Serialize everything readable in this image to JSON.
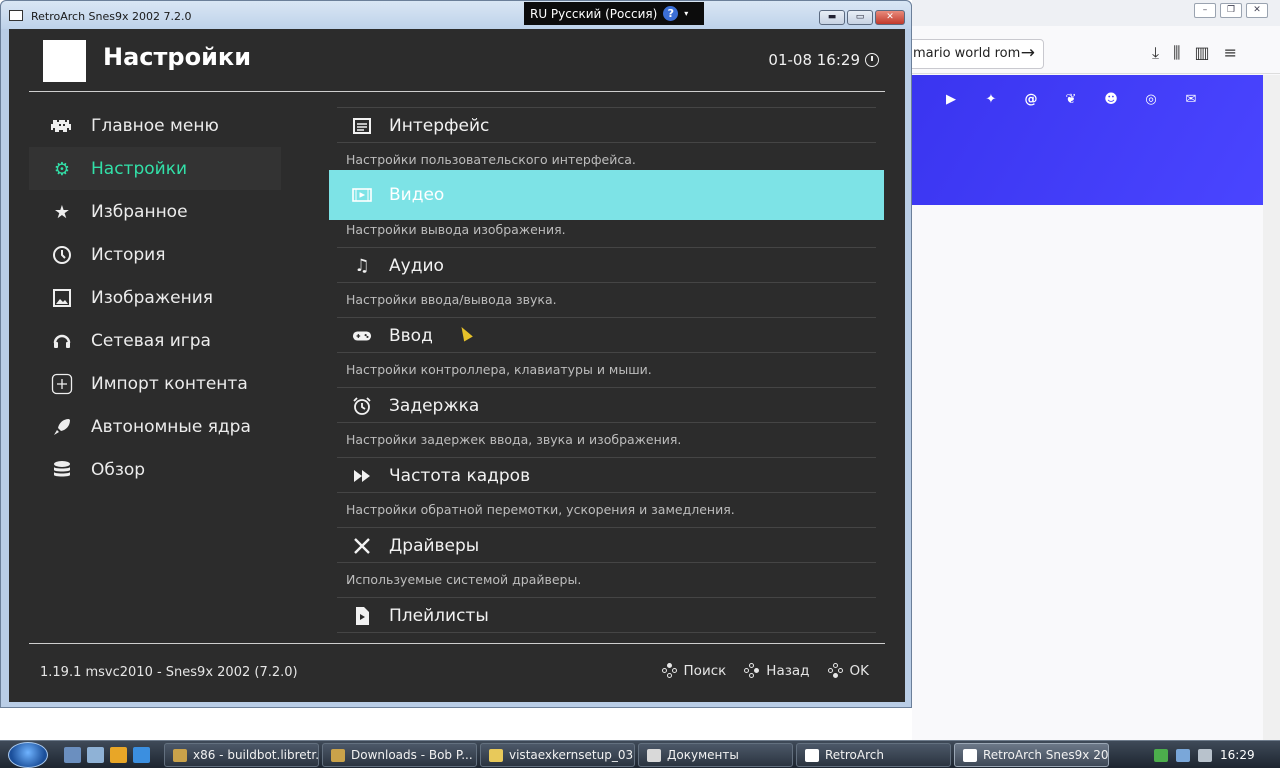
{
  "browser": {
    "url_fragment": "mario world rom",
    "social_icons": [
      "youtube-icon",
      "twitter-icon",
      "mastodon-icon",
      "bluesky-icon",
      "discord-icon",
      "github-icon",
      "email-icon"
    ],
    "banner_color": "#3d38f5"
  },
  "language_bar": {
    "label": "RU Русский (Россия)",
    "help": "?"
  },
  "window": {
    "title": "RetroArch Snes9x 2002 7.2.0"
  },
  "header": {
    "title": "Настройки",
    "clock": "01-08 16:29"
  },
  "sidebar": {
    "items": [
      {
        "label": "Главное меню",
        "icon": "invader-icon"
      },
      {
        "label": "Настройки",
        "icon": "gear-icon",
        "active": true
      },
      {
        "label": "Избранное",
        "icon": "star-icon"
      },
      {
        "label": "История",
        "icon": "history-icon"
      },
      {
        "label": "Изображения",
        "icon": "image-icon"
      },
      {
        "label": "Сетевая игра",
        "icon": "netplay-icon"
      },
      {
        "label": "Импорт контента",
        "icon": "plus-icon"
      },
      {
        "label": "Автономные ядра",
        "icon": "rocket-icon"
      },
      {
        "label": "Обзор",
        "icon": "database-icon"
      }
    ],
    "accent_color": "#32e0a8"
  },
  "menu": {
    "items": [
      {
        "label": "Интерфейс",
        "desc": "Настройки пользовательского интерфейса.",
        "icon": "interface-icon"
      },
      {
        "label": "Видео",
        "desc": "Настройки вывода изображения.",
        "icon": "video-icon",
        "selected": true
      },
      {
        "label": "Аудио",
        "desc": "Настройки ввода/вывода звука.",
        "icon": "music-note-icon"
      },
      {
        "label": "Ввод",
        "desc": "Настройки контроллера, клавиатуры и мыши.",
        "icon": "gamepad-icon"
      },
      {
        "label": "Задержка",
        "desc": "Настройки задержек ввода, звука и изображения.",
        "icon": "alarm-clock-icon"
      },
      {
        "label": "Частота кадров",
        "desc": "Настройки обратной перемотки, ускорения и замедления.",
        "icon": "fast-forward-icon"
      },
      {
        "label": "Драйверы",
        "desc": "Используемые системой драйверы.",
        "icon": "tools-icon"
      },
      {
        "label": "Плейлисты",
        "desc": "",
        "icon": "file-icon"
      }
    ],
    "selection_color": "#7de3e6"
  },
  "footer": {
    "version": "1.19.1 msvc2010 - Snes9x 2002 (7.2.0)",
    "hints": [
      "Поиск",
      "Назад",
      "OK"
    ]
  },
  "taskbar": {
    "tasks": [
      {
        "label": "x86 - buildbot.libretr..."
      },
      {
        "label": "Downloads - Bob P..."
      },
      {
        "label": "vistaexkernsetup_03..."
      },
      {
        "label": "Документы"
      },
      {
        "label": "RetroArch"
      },
      {
        "label": "RetroArch Snes9x 20...",
        "active": true
      }
    ],
    "clock": "16:29"
  }
}
